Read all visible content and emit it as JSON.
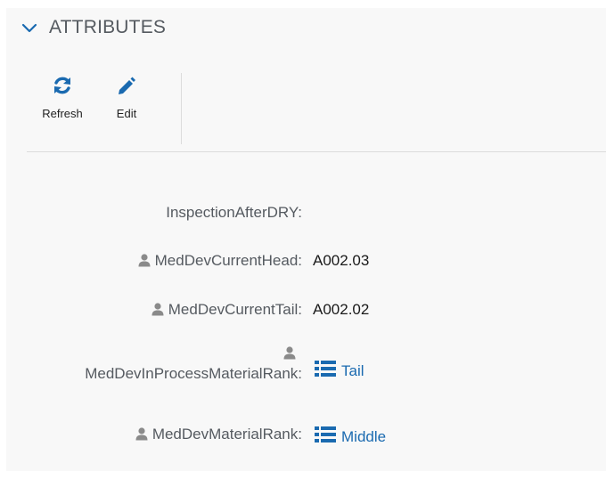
{
  "section": {
    "title": "ATTRIBUTES",
    "collapse_icon": "chevron-down-icon"
  },
  "toolbar": {
    "refresh_label": "Refresh",
    "refresh_icon": "refresh-icon",
    "edit_label": "Edit",
    "edit_icon": "pencil-icon"
  },
  "attributes": [
    {
      "label": "InspectionAfterDRY:",
      "value": "",
      "type": "text",
      "user_icon": false
    },
    {
      "label": "MedDevCurrentHead:",
      "value": "A002.03",
      "type": "text",
      "user_icon": true
    },
    {
      "label": "MedDevCurrentTail:",
      "value": "A002.02",
      "type": "text",
      "user_icon": true
    },
    {
      "label": "MedDevInProcessMaterialRank:",
      "value": "Tail",
      "type": "link",
      "user_icon": true
    },
    {
      "label": "MedDevMaterialRank:",
      "value": "Middle",
      "type": "link",
      "user_icon": true
    }
  ],
  "colors": {
    "accent": "#1a6ab0",
    "label": "#555a60",
    "icon_gray": "#8a8a8a",
    "panel_bg": "#f8f8f8"
  }
}
